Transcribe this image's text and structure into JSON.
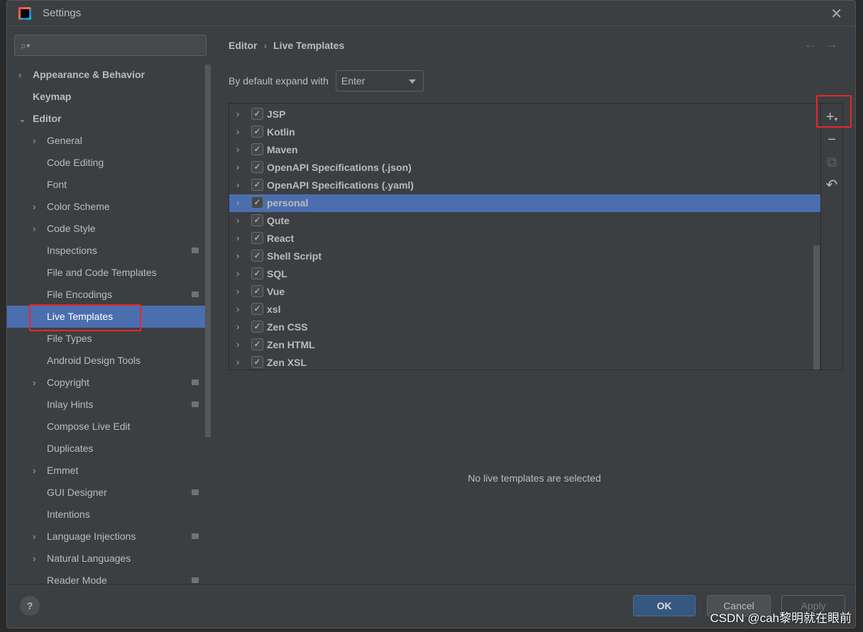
{
  "window": {
    "title": "Settings"
  },
  "sidebar": {
    "search_placeholder": "",
    "items": [
      {
        "label": "Appearance & Behavior",
        "level": 0,
        "chevron": "right",
        "bold": true
      },
      {
        "label": "Keymap",
        "level": 0,
        "chevron": "",
        "bold": true
      },
      {
        "label": "Editor",
        "level": 0,
        "chevron": "down",
        "bold": true
      },
      {
        "label": "General",
        "level": 1,
        "chevron": "right"
      },
      {
        "label": "Code Editing",
        "level": 1,
        "chevron": ""
      },
      {
        "label": "Font",
        "level": 1,
        "chevron": ""
      },
      {
        "label": "Color Scheme",
        "level": 1,
        "chevron": "right"
      },
      {
        "label": "Code Style",
        "level": 1,
        "chevron": "right"
      },
      {
        "label": "Inspections",
        "level": 1,
        "chevron": "",
        "project": true
      },
      {
        "label": "File and Code Templates",
        "level": 1,
        "chevron": ""
      },
      {
        "label": "File Encodings",
        "level": 1,
        "chevron": "",
        "project": true
      },
      {
        "label": "Live Templates",
        "level": 1,
        "chevron": "",
        "selected": true
      },
      {
        "label": "File Types",
        "level": 1,
        "chevron": ""
      },
      {
        "label": "Android Design Tools",
        "level": 1,
        "chevron": ""
      },
      {
        "label": "Copyright",
        "level": 1,
        "chevron": "right",
        "project": true
      },
      {
        "label": "Inlay Hints",
        "level": 1,
        "chevron": "",
        "project": true
      },
      {
        "label": "Compose Live Edit",
        "level": 1,
        "chevron": ""
      },
      {
        "label": "Duplicates",
        "level": 1,
        "chevron": ""
      },
      {
        "label": "Emmet",
        "level": 1,
        "chevron": "right"
      },
      {
        "label": "GUI Designer",
        "level": 1,
        "chevron": "",
        "project": true
      },
      {
        "label": "Intentions",
        "level": 1,
        "chevron": ""
      },
      {
        "label": "Language Injections",
        "level": 1,
        "chevron": "right",
        "project": true
      },
      {
        "label": "Natural Languages",
        "level": 1,
        "chevron": "right"
      },
      {
        "label": "Reader Mode",
        "level": 1,
        "chevron": "",
        "project": true
      }
    ]
  },
  "main": {
    "breadcrumb": [
      "Editor",
      "Live Templates"
    ],
    "expand_label": "By default expand with",
    "expand_value": "Enter",
    "groups": [
      {
        "label": "JSP",
        "checked": true
      },
      {
        "label": "Kotlin",
        "checked": true
      },
      {
        "label": "Maven",
        "checked": true
      },
      {
        "label": "OpenAPI Specifications (.json)",
        "checked": true
      },
      {
        "label": "OpenAPI Specifications (.yaml)",
        "checked": true
      },
      {
        "label": "personal",
        "checked": true,
        "selected": true
      },
      {
        "label": "Qute",
        "checked": true
      },
      {
        "label": "React",
        "checked": true
      },
      {
        "label": "Shell Script",
        "checked": true
      },
      {
        "label": "SQL",
        "checked": true
      },
      {
        "label": "Vue",
        "checked": true
      },
      {
        "label": "xsl",
        "checked": true
      },
      {
        "label": "Zen CSS",
        "checked": true
      },
      {
        "label": "Zen HTML",
        "checked": true
      },
      {
        "label": "Zen XSL",
        "checked": true
      }
    ],
    "tools": [
      "add-icon",
      "remove-icon",
      "copy-icon",
      "restore-icon"
    ],
    "empty_text": "No live templates are selected"
  },
  "footer": {
    "help": "?",
    "ok": "OK",
    "cancel": "Cancel",
    "apply": "Apply"
  },
  "watermark": "CSDN @cah黎明就在眼前",
  "colors": {
    "selection": "#4b6eaf",
    "highlight_box": "#e8262c",
    "ok_button": "#365880"
  }
}
